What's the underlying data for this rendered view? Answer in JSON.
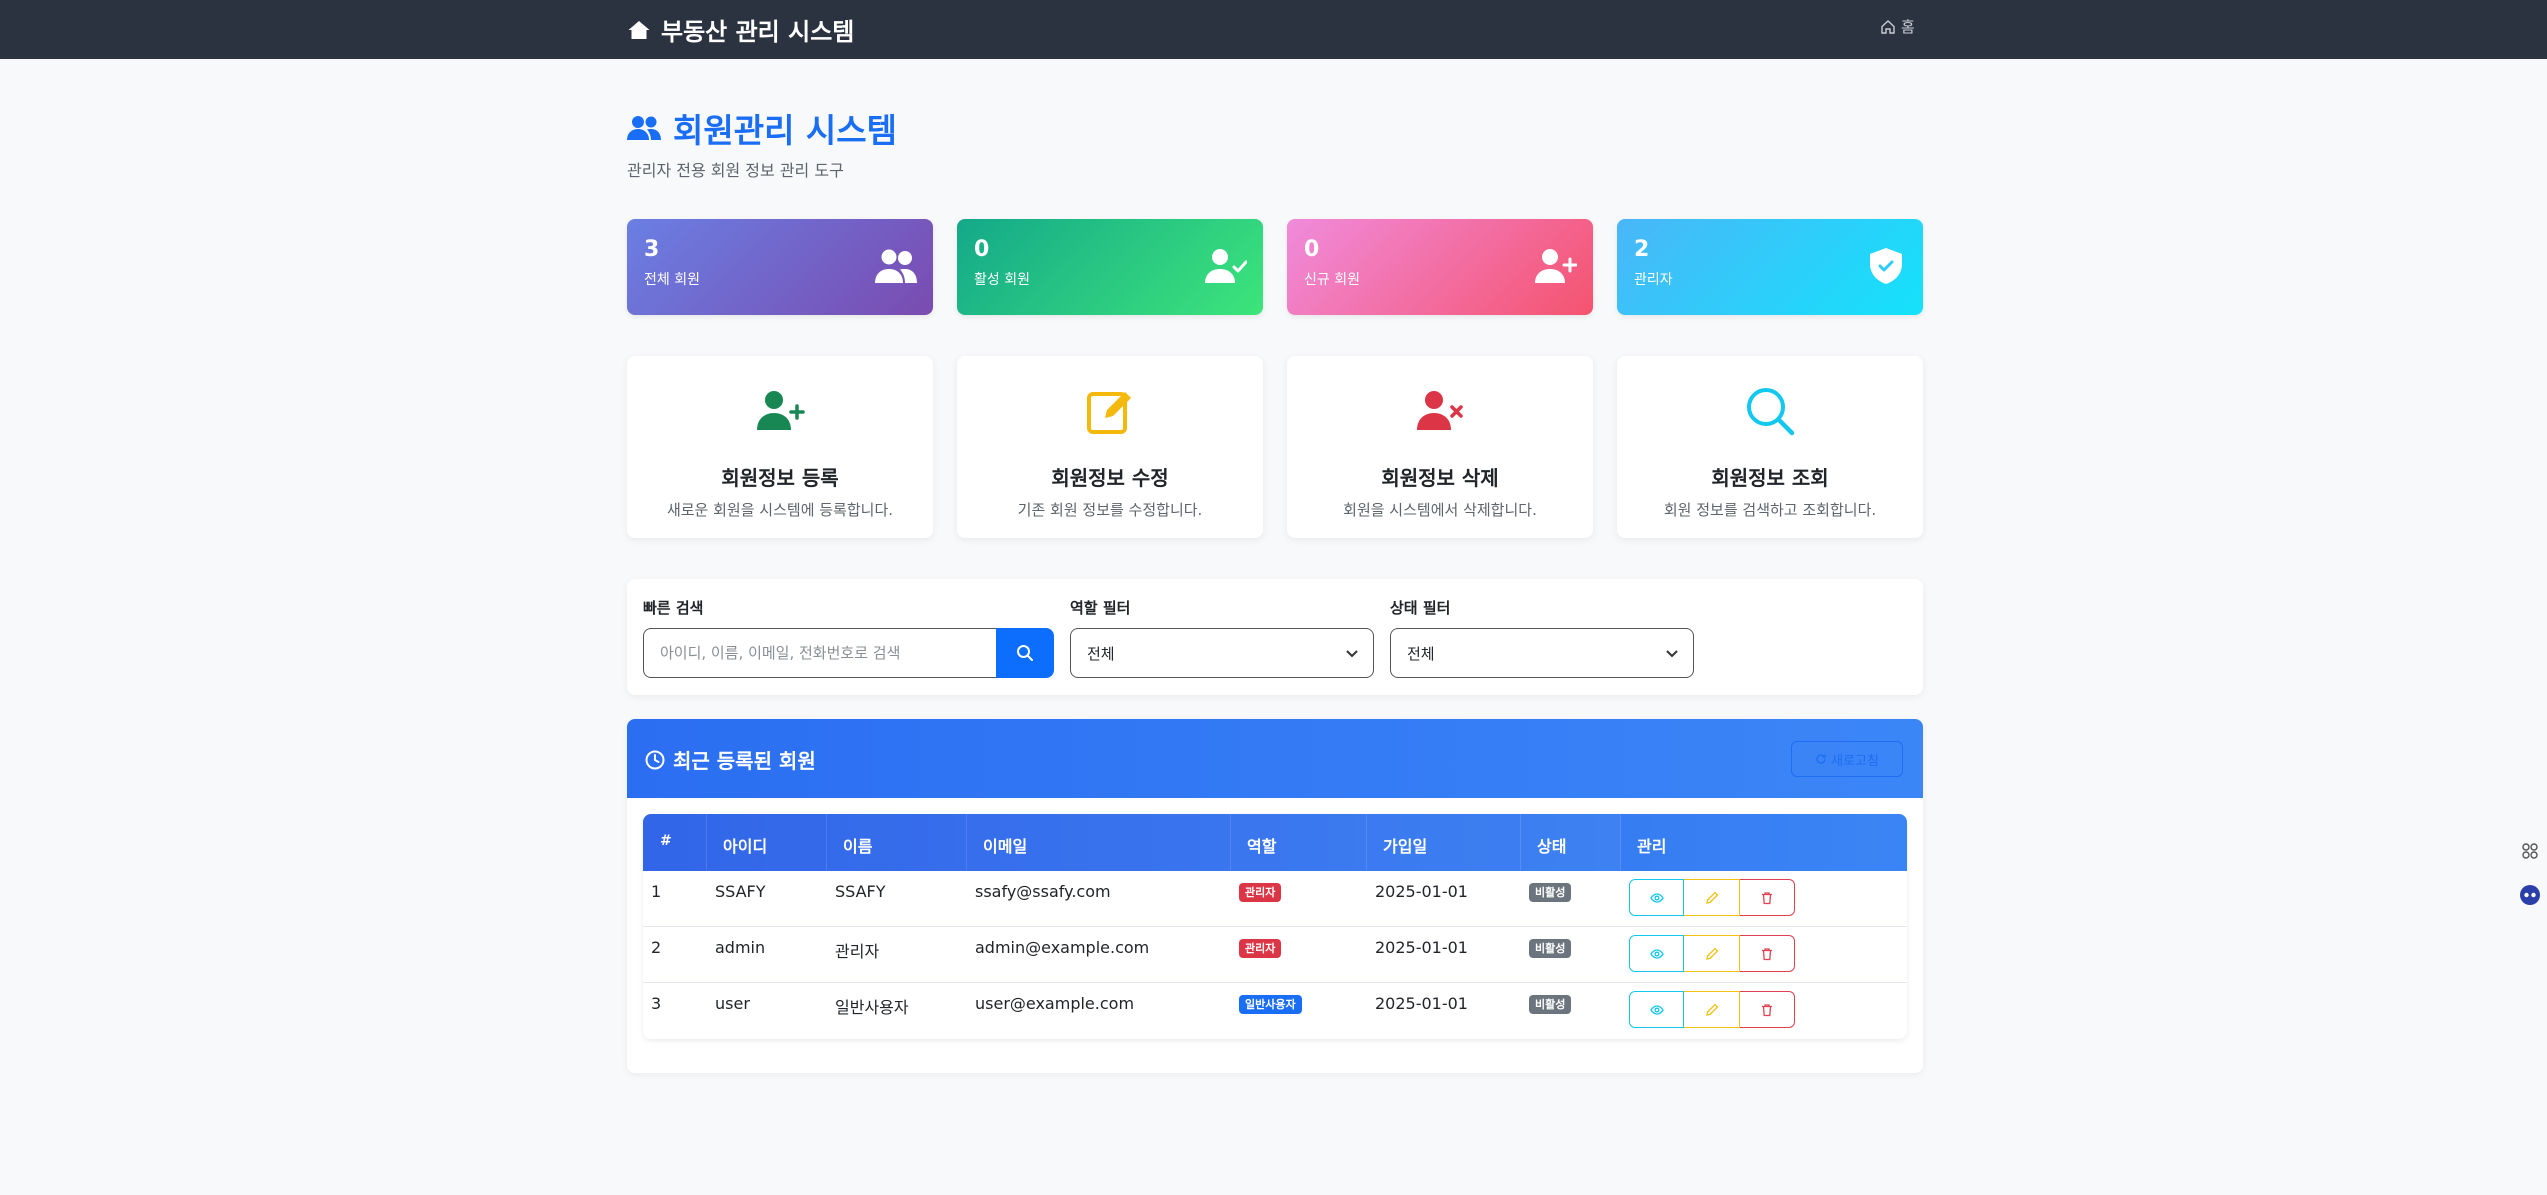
{
  "nav": {
    "brand": "부동산 관리 시스템",
    "home": "홈"
  },
  "header": {
    "title": "회원관리 시스템",
    "subtitle": "관리자 전용 회원 정보 관리 도구"
  },
  "stats": [
    {
      "value": "3",
      "label": "전체 회원",
      "icon": "users-icon"
    },
    {
      "value": "0",
      "label": "활성 회원",
      "icon": "user-check-icon"
    },
    {
      "value": "0",
      "label": "신규 회원",
      "icon": "user-plus-icon"
    },
    {
      "value": "2",
      "label": "관리자",
      "icon": "shield-check-icon"
    }
  ],
  "actions": [
    {
      "title": "회원정보 등록",
      "desc": "새로운 회원을 시스템에 등록합니다.",
      "icon": "user-plus-icon",
      "color": "#198754"
    },
    {
      "title": "회원정보 수정",
      "desc": "기존 회원 정보를 수정합니다.",
      "icon": "edit-icon",
      "color": "#f5b80c"
    },
    {
      "title": "회원정보 삭제",
      "desc": "회원을 시스템에서 삭제합니다.",
      "icon": "user-x-icon",
      "color": "#dc3545"
    },
    {
      "title": "회원정보 조회",
      "desc": "회원 정보를 검색하고 조회합니다.",
      "icon": "search-icon",
      "color": "#12c8ef"
    }
  ],
  "filters": {
    "search_label": "빠른 검색",
    "search_placeholder": "아이디, 이름, 이메일, 전화번호로 검색",
    "role_label": "역할 필터",
    "role_value": "전체",
    "status_label": "상태 필터",
    "status_value": "전체"
  },
  "recent": {
    "title": "최근 등록된 회원",
    "refresh": "새로고침",
    "columns": [
      "#",
      "아이디",
      "이름",
      "이메일",
      "역할",
      "가입일",
      "상태",
      "관리"
    ],
    "rows": [
      {
        "no": "1",
        "id": "SSAFY",
        "name": "SSAFY",
        "email": "ssafy@ssafy.com",
        "role": "관리자",
        "role_type": "admin",
        "joined": "2025-01-01",
        "status": "비활성"
      },
      {
        "no": "2",
        "id": "admin",
        "name": "관리자",
        "email": "admin@example.com",
        "role": "관리자",
        "role_type": "admin",
        "joined": "2025-01-01",
        "status": "비활성"
      },
      {
        "no": "3",
        "id": "user",
        "name": "일반사용자",
        "email": "user@example.com",
        "role": "일반사용자",
        "role_type": "user",
        "joined": "2025-01-01",
        "status": "비활성"
      }
    ]
  },
  "colors": {
    "primary": "#0d6efd",
    "navbar": "#2b3341",
    "danger": "#dc3545",
    "success": "#198754",
    "warning": "#f5b80c",
    "info": "#12c8ef"
  }
}
